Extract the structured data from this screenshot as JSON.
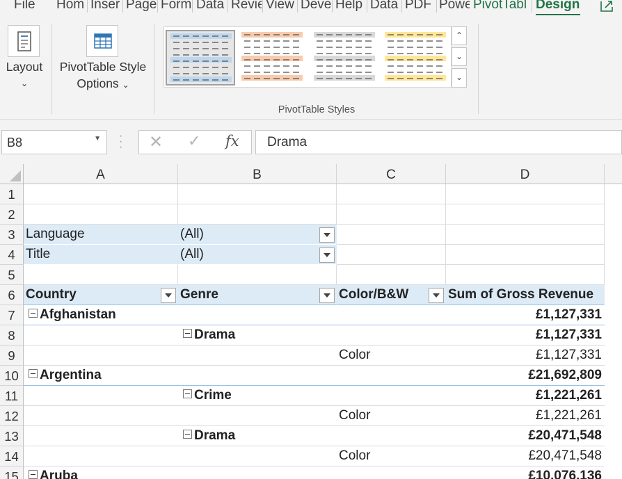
{
  "ribbon": {
    "tabs": [
      {
        "label": "File"
      },
      {
        "label": "Hom"
      },
      {
        "label": "Inser"
      },
      {
        "label": "Page"
      },
      {
        "label": "Form"
      },
      {
        "label": "Data"
      },
      {
        "label": "Revie"
      },
      {
        "label": "View"
      },
      {
        "label": "Deve"
      },
      {
        "label": "Help"
      },
      {
        "label": "Data"
      },
      {
        "label": "PDF"
      },
      {
        "label": "Powe"
      },
      {
        "label": "PivotTabl"
      },
      {
        "label": "Design"
      }
    ],
    "layout_label": "Layout",
    "style_options_label_1": "PivotTable Style",
    "style_options_label_2": "Options",
    "group_label": "PivotTable Styles",
    "style_swatches": [
      "#bdd7ee",
      "#f8cbad",
      "#d9d9d9",
      "#ffe699"
    ],
    "accent_color": "#217346"
  },
  "formula_bar": {
    "name_box": "B8",
    "content": "Drama"
  },
  "columns": [
    "A",
    "B",
    "C",
    "D"
  ],
  "rows": [
    "1",
    "2",
    "3",
    "4",
    "5",
    "6",
    "7",
    "8",
    "9",
    "10",
    "11",
    "12",
    "13",
    "14",
    "15"
  ],
  "filters": [
    {
      "label": "Language",
      "value": "(All)"
    },
    {
      "label": "Title",
      "value": "(All)"
    }
  ],
  "pivot_headers": [
    "Country",
    "Genre",
    "Color/B&W",
    "Sum of Gross Revenue"
  ],
  "pivot_rows": [
    {
      "a": "Afghanistan",
      "b": "",
      "c": "",
      "d": "£1,127,331"
    },
    {
      "a": "",
      "b": "Drama",
      "c": "",
      "d": "£1,127,331"
    },
    {
      "a": "",
      "b": "",
      "c": "Color",
      "d": "£1,127,331"
    },
    {
      "a": "Argentina",
      "b": "",
      "c": "",
      "d": "£21,692,809"
    },
    {
      "a": "",
      "b": "Crime",
      "c": "",
      "d": "£1,221,261"
    },
    {
      "a": "",
      "b": "",
      "c": "Color",
      "d": "£1,221,261"
    },
    {
      "a": "",
      "b": "Drama",
      "c": "",
      "d": "£20,471,548"
    },
    {
      "a": "",
      "b": "",
      "c": "Color",
      "d": "£20,471,548"
    },
    {
      "a": "Aruba",
      "b": "",
      "c": "",
      "d": "£10,076,136"
    }
  ],
  "colors": {
    "pivot_header_fill": "#ddebf7",
    "pivot_border": "#9bc2e6",
    "chrome": "#f3f3f3"
  }
}
